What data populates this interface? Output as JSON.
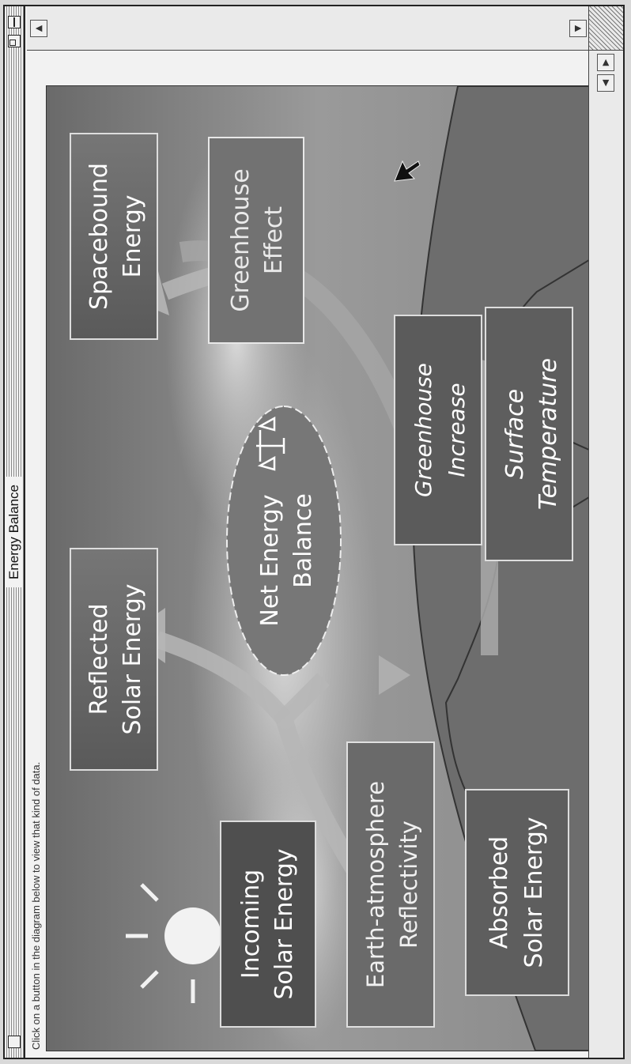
{
  "window": {
    "title": "Energy Balance",
    "instruction": "Click on a button in the diagram below to view that kind of data."
  },
  "diagram": {
    "buttons": {
      "incoming": [
        "Incoming",
        "Solar Energy"
      ],
      "reflected": [
        "Reflected",
        "Solar Energy"
      ],
      "spacebound": [
        "Spacebound",
        "Energy"
      ],
      "reflectivity": [
        "Earth-atmosphere",
        "Reflectivity"
      ],
      "net_balance": [
        "Net Energy",
        "Balance"
      ],
      "greenhouse_effect": [
        "Greenhouse",
        "Effect"
      ],
      "absorbed": [
        "Absorbed",
        "Solar Energy"
      ],
      "greenhouse_increase": [
        "Greenhouse",
        "Increase"
      ],
      "surface_temperature": [
        "Surface",
        "Temperature"
      ]
    },
    "icons": {
      "sun": "sun-icon",
      "scale": "balance-scale-icon",
      "cursor": "mouse-pointer-icon"
    }
  }
}
